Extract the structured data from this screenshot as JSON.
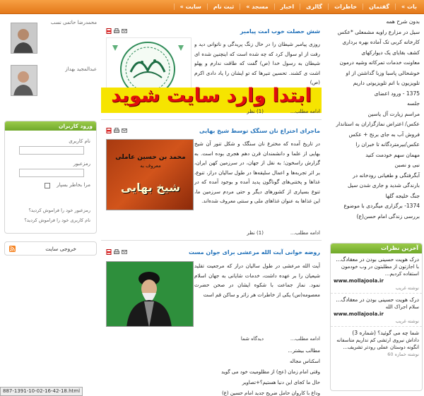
{
  "nav": {
    "items": [
      "بات »",
      "گفتمان",
      "خاطرات",
      "گالری",
      "اخبار",
      "مسجد »",
      "ثبت نام",
      "سایت »"
    ]
  },
  "right_menu": {
    "items": [
      "بدون شرح همه",
      "سیل در مزارع راویه مشمعلی *عکس",
      "کارخانه کربی تک آماده بهره برداری",
      "کشف بقایای یک دیوارکهای",
      "معاونت خدمات تمرکاته وشیه درمون",
      "خوشحالی پاسبا وزبا گداشتن از او",
      "تلویزیون با اتم تلویزیوتی داریم",
      "1375 - ورود اعضای",
      "جلسه",
      "مراسم زیارت آل یاسین",
      "عکس/ اعتراض نمازگزاران به استاندار",
      "فروش آب به جای برنج + عکس",
      "عکس/بیرمتردگانه تا خبران را",
      "مهمان سهم خودمت کنید",
      "نبی و نصبن",
      "آبگرفتگی و طغیانی رودخانه در",
      "بارندگی شدید و جاری شدن سیل",
      "جنگ خلیجه گلها",
      "1374- برگزاری میگردی با موضوع",
      "بررسی زندگی امام حسن(ع)"
    ]
  },
  "latest_comments": {
    "header": "آخرین نظرات",
    "items": [
      {
        "title": "درک هویت حسینی بودن در معقادگ...",
        "text": "با اجازتون از مطلبتون در وب خودمون استفاده کردیم...",
        "site": "www.mollajoola.ir",
        "meta": "نوشته غریب"
      },
      {
        "title": "درک هویت حسینی بودن در معقادگ...",
        "text": "سلام اجراک الله",
        "site": "www.mollajoola.ir",
        "meta": "نوشته غریب"
      },
      {
        "title": "شما چه می گوئید؟ (شماره 3)",
        "text": "داداش نیروی ارتشی کم نداریم متاسفانه انگونه دوستان عملی رودتر تشریف...",
        "site": "",
        "meta": "نوشته خمازه 60"
      }
    ]
  },
  "articles": [
    {
      "title": "شش حصلت خوب امت پیامبر",
      "body": "روزی پیامبر شیطان را در حال زنگ پریدگی و ناتوانی دید و رفت از او سوال کرد که چه شده است که اینچنین شده ای شیطان به رسول خدا (ص) گفت که طاقت ندارم و پهلو اشت ی کشند. تحسین تنیرها که تو ایشان را یاد دادی اکرم (ص)",
      "read_more": "ادامه مطلب...",
      "comments": "(1) نظر"
    },
    {
      "title": "ماجرای اختراع نان سنگک توسط شیخ بهایی",
      "body": "در تاریخ آمده که مخترع نان سنگک و شکل تنور آن شیخ بهایی از علما و دانشمندان قرن دهم هجری بوده است. به گزارش راسخون؛ به نقل از جهان، در سرزمین کهن ایران، بر اثر تجربه‌ها و اعمال سلیقه‌ها در طول سالیان دراز، تنوع، غذاها و پختنی‌های گوناگون پدید آمده و بوجود آمده که در تنوع بسیاری از کشورهای دیگر و حتی مردم سرزمین ما، این غذاها به عنوان غذاهای ملی و سنتی معروف شده‌اند.",
      "read_more": "ادامه مطلب...",
      "comments": "(1) نظر",
      "image_line1": "محمد بن حسین عاملی",
      "image_line2": "معروف به",
      "image_line3": "شیخ بهایی"
    },
    {
      "title": "روضه خوانی آیت الله مرعشی برای جوان مست",
      "body": "آیت الله مرعشی در طول سالیان دراز که مرجعیت تقلید شیعیان را بر عهده داشت، خدمات شایانی به جهان اسلام نمود. نماز جماعت با شکوه ایشان در صحن حضرت معصومه(س) یکی از خاطرات هر زائر و ساکن قم است",
      "read_more": "ادامه مطلب...",
      "comments": "دیدگاه شما",
      "sub_lines": [
        "مطالب بیشتر...",
        "اسکناس مجاله",
        "وقتی امام زمان (عج) از مظلومیت خود می گوید",
        "حال ما کجای این دنیا هستیم؟+تصاویر",
        "وداع با کاروان حامل ضریح جدید امام حسین (ع)"
      ]
    }
  ],
  "overlay_text": "ابتدا وارد سایت شوید",
  "left_col": {
    "profiles": [
      "محمدرضا حاتمی نسب",
      "عبدالمجید بهداز"
    ],
    "login": {
      "header": "ورود کاربران",
      "username_label": "نام کاربری",
      "password_label": "رمزعبور",
      "remember_label": "مرا بخاطر بسپار",
      "forgot_password": "رمزعبور خود را فراموش کردید؟",
      "forgot_username": "نام کاربری خود را فراموش کردید؟"
    },
    "logout_label": "خروجی سایت"
  },
  "status_bar": "887-1391-10-02-16-42-18.html",
  "colors": {
    "nav_bg": "#e8821f",
    "title_blue": "#1e6fb8",
    "green_header": "#7bb433",
    "overlay_red": "#e10d0d",
    "overlay_yellow": "#f6e400"
  }
}
